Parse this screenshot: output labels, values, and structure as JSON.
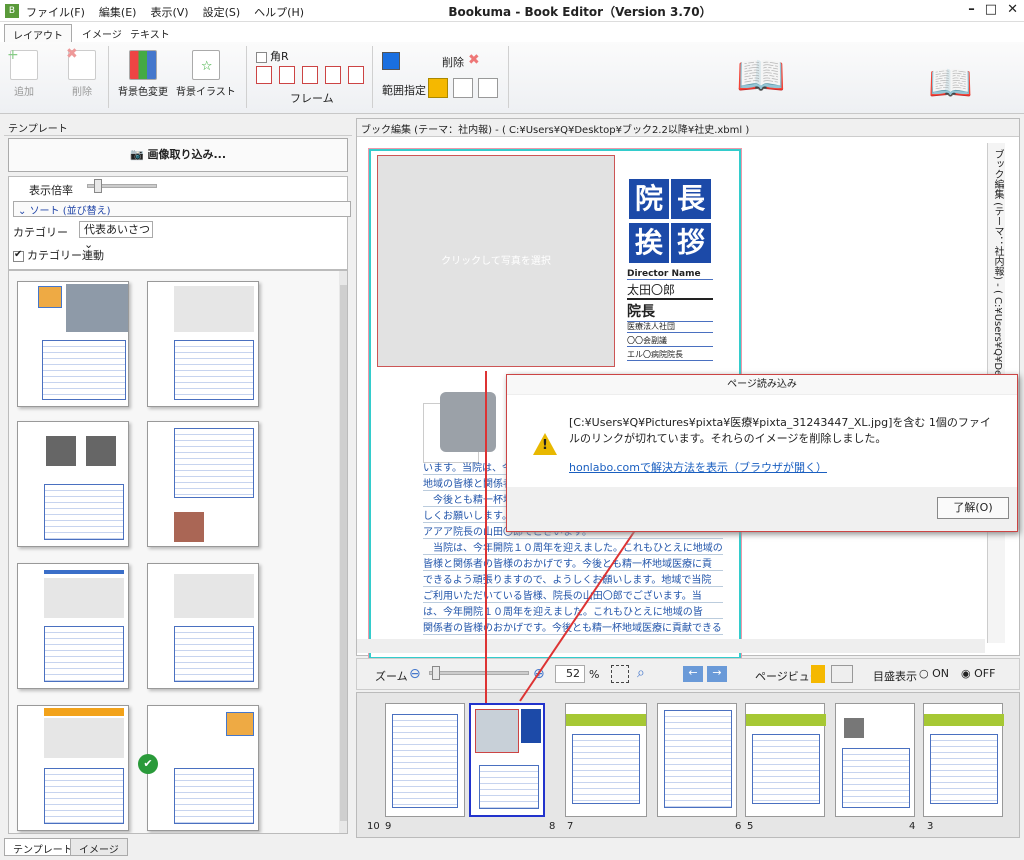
{
  "titlebar": {
    "title": "Bookuma - Book Editor（Version 3.70）",
    "menu": [
      "ファイル(F)",
      "編集(E)",
      "表示(V)",
      "設定(S)",
      "ヘルプ(H)"
    ]
  },
  "ribbon": {
    "tabs": [
      "レイアウト",
      "イメージ",
      "テキスト"
    ],
    "add": "追加",
    "delete": "削除",
    "bg_color": "背景色変更",
    "bg_illust": "背景イラスト",
    "kakuR": "角R",
    "frame": "フレーム",
    "range": "範囲指定",
    "delete2": "削除"
  },
  "left": {
    "header": "テンプレート",
    "import": "画像取り込み...",
    "zoom_label": "表示倍率",
    "sort": "ソート (並び替え)",
    "category_label": "カテゴリー",
    "category_value": "代表あいさつ",
    "category_link": "カテゴリー連動",
    "tabs": [
      "テンプレート",
      "イメージ"
    ]
  },
  "editor": {
    "header": "ブック編集 (テーマ：社内報) - ( C:¥Users¥Q¥Desktop¥ブック2.2以降¥社史.xbml )",
    "vtab": "ブック編集 (テーマ：社内報) - ( C:¥Users¥Q¥Desktop¥",
    "photo_hint": "クリックして写真を選択",
    "kanji": [
      "院",
      "長",
      "挨",
      "拶"
    ],
    "director_label": "Director Name",
    "director_name": "太田〇郎",
    "role": "院長",
    "rows": [
      "医療法人社団",
      "〇〇会副議",
      "エル〇病院院長"
    ],
    "body_lines": [
      "います。当院は、今",
      "地域の皆様と関係者",
      "　今後とも精一杯地",
      "しくお願いします。",
      "アアア院長の山田〇郎でございます。",
      "　当院は、今年開院１０周年を迎えました。これもひとえに地域の",
      "皆様と関係者の皆様のおかげです。今後とも精一杯地域医療に貢",
      "できるよう頑張りますので、ようしくお願いします。地域で当院",
      "ご利用いただいている皆様、院長の山田〇郎でございます。当",
      "は、今年開院１０周年を迎えました。これもひとえに地域の皆",
      "関係者の皆様のおかげです。今後とも精一杯地域医療に貢献できる"
    ]
  },
  "zoombar": {
    "label": "ズーム",
    "value": "52",
    "unit": "%",
    "page_view": "ページビュー",
    "grid_label": "目盛表示",
    "on": "ON",
    "off": "OFF",
    "grid_state": "OFF"
  },
  "strip": {
    "page_numbers": [
      "10",
      "9",
      "8",
      "7",
      "6",
      "5",
      "4",
      "3"
    ]
  },
  "dialog": {
    "title": "ページ読み込み",
    "message": "[C:¥Users¥Q¥Pictures¥pixta¥医療¥pixta_31243447_XL.jpg]を含む 1個のファイルのリンクが切れています。それらのイメージを削除しました。",
    "link": "honlabo.comで解決方法を表示（ブラウザが開く）",
    "ok": "了解(O)"
  },
  "colors": {
    "accent": "#1c4aa8",
    "frame": "#33cccc",
    "warn": "#e8b800",
    "annotation": "#dd3333"
  }
}
